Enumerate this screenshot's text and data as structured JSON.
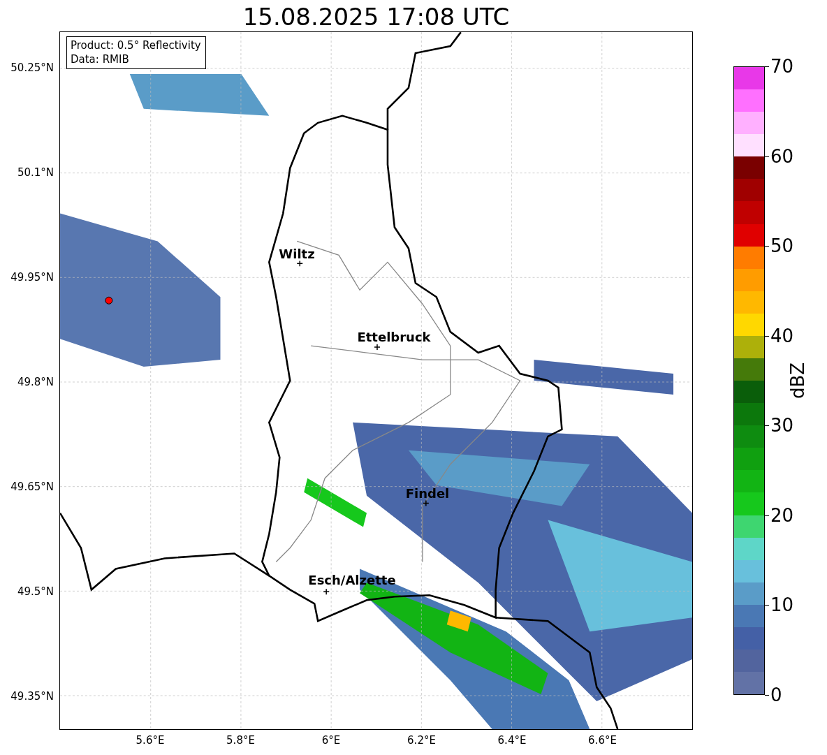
{
  "title": "15.08.2025 17:08 UTC",
  "info_box": [
    "Product: 0.5° Reflectivity",
    "Data: RMIB"
  ],
  "lat_ticks": [
    "50.25°N",
    "50.1°N",
    "49.95°N",
    "49.8°N",
    "49.65°N",
    "49.5°N",
    "49.35°N"
  ],
  "lon_ticks": [
    "5.6°E",
    "5.8°E",
    "6°E",
    "6.2°E",
    "6.4°E",
    "6.6°E"
  ],
  "cities": [
    {
      "name": "Wiltz"
    },
    {
      "name": "Ettelbruck"
    },
    {
      "name": "Findel"
    },
    {
      "name": "Esch/Alzette"
    }
  ],
  "colorbar": {
    "label": "dBZ",
    "ticks": [
      "70",
      "60",
      "50",
      "40",
      "30",
      "20",
      "10",
      "0"
    ],
    "bins": [
      {
        "color": "#e838e8"
      },
      {
        "color": "#ff70ff"
      },
      {
        "color": "#ffb0ff"
      },
      {
        "color": "#ffe0ff"
      },
      {
        "color": "#7a0000"
      },
      {
        "color": "#a00000"
      },
      {
        "color": "#c00000"
      },
      {
        "color": "#e00000"
      },
      {
        "color": "#ff7c00"
      },
      {
        "color": "#ff9c00"
      },
      {
        "color": "#ffb800"
      },
      {
        "color": "#ffd800"
      },
      {
        "color": "#adb00a"
      },
      {
        "color": "#457a0a"
      },
      {
        "color": "#0a5e0a"
      },
      {
        "color": "#0c780c"
      },
      {
        "color": "#0e8c10"
      },
      {
        "color": "#10a010"
      },
      {
        "color": "#12b414"
      },
      {
        "color": "#16c81c"
      },
      {
        "color": "#3ed670"
      },
      {
        "color": "#5ed6c8"
      },
      {
        "color": "#68c0dc"
      },
      {
        "color": "#5a9cc8"
      },
      {
        "color": "#4a78b4"
      },
      {
        "color": "#4460a6"
      },
      {
        "color": "#52649e"
      },
      {
        "color": "#6272a6"
      }
    ]
  }
}
